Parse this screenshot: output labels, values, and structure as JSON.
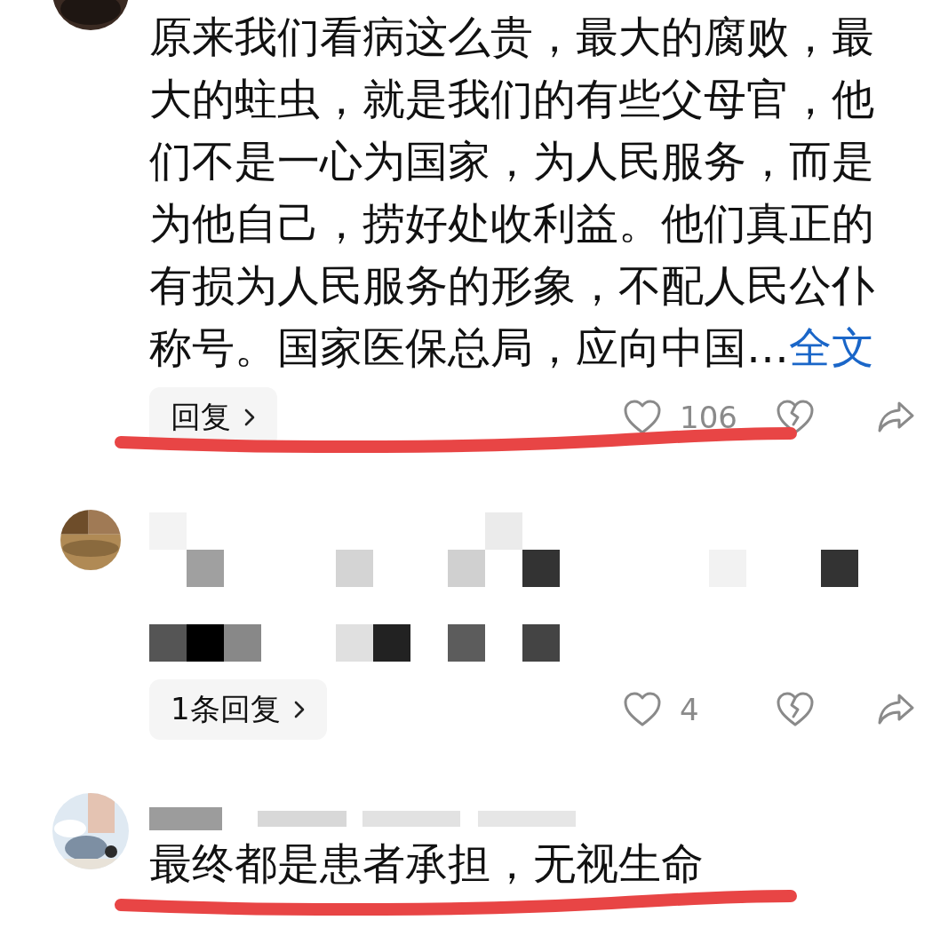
{
  "comments": [
    {
      "redacted": false,
      "text": "原来我们看病这么贵，最大的腐败，最大的蛀虫，就是我们的有些父母官，他们不是一心为国家，为人民服务，而是为他自己，捞好处收利益。他们真正的有损为人民服务的形象，不配人民公仆称号。国家医保总局，应向中国…",
      "expand_link": "全文",
      "reply_button": "回复",
      "likes": "106",
      "underlined": true
    },
    {
      "redacted": true,
      "reply_button": "1条回复",
      "likes": "4",
      "underlined": false
    },
    {
      "redacted": false,
      "meta_redacted": true,
      "text": "最终都是患者承担，无视生命",
      "underlined": true
    }
  ]
}
